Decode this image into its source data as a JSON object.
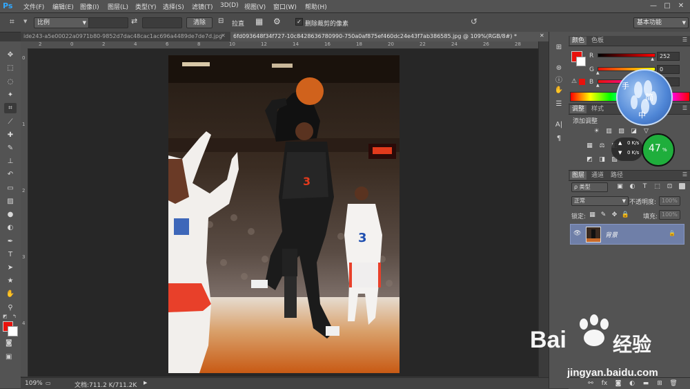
{
  "app": {
    "logo": "Ps",
    "menus": [
      "文件(F)",
      "编辑(E)",
      "图像(I)",
      "图层(L)",
      "类型(Y)",
      "选择(S)",
      "滤镜(T)",
      "3D(D)",
      "视图(V)",
      "窗口(W)",
      "帮助(H)"
    ],
    "window_controls": {
      "minimize": "—",
      "restore": "□",
      "close": "✕"
    }
  },
  "options_bar": {
    "ratio_select": "比例",
    "swap_symbol": "⇄",
    "clear_button": "清除",
    "straighten_label": "拉直",
    "delete_cropped_label": "删除裁剪的像素",
    "delete_cropped_checked": true,
    "workspace_select": "基本功能"
  },
  "tabs": [
    {
      "label": "ide243-a5e00022a0971b80-9852d7dac48cac1ac696a4489de7de7d.jpg",
      "close": "✕",
      "active": false
    },
    {
      "label": "6fd093648f34f727-10c8428636780990-750a0af875ef460dc24e43f7ab386585.jpg @ 109%(RGB/8#) *",
      "close": "✕",
      "active": true
    }
  ],
  "rulers": {
    "top_ticks": [
      "2",
      "0",
      "2",
      "4",
      "6",
      "8",
      "10",
      "12",
      "14",
      "16",
      "18",
      "20",
      "22",
      "24",
      "26",
      "28",
      "30"
    ],
    "left_ticks": [
      "0",
      "1",
      "2",
      "3",
      "4"
    ]
  },
  "tools": [
    {
      "icon": "move-tool-icon",
      "glyph": "✥"
    },
    {
      "icon": "marquee-tool-icon",
      "glyph": "⬚"
    },
    {
      "icon": "lasso-tool-icon",
      "glyph": "◌"
    },
    {
      "icon": "magic-wand-icon",
      "glyph": "✦"
    },
    {
      "icon": "crop-tool-icon",
      "glyph": "⌗"
    },
    {
      "icon": "eyedropper-icon",
      "glyph": "⟋"
    },
    {
      "icon": "healing-brush-icon",
      "glyph": "✚"
    },
    {
      "icon": "brush-tool-icon",
      "glyph": "✎"
    },
    {
      "icon": "clone-stamp-icon",
      "glyph": "⊥"
    },
    {
      "icon": "history-brush-icon",
      "glyph": "↶"
    },
    {
      "icon": "eraser-icon",
      "glyph": "▭"
    },
    {
      "icon": "gradient-tool-icon",
      "glyph": "▨"
    },
    {
      "icon": "blur-tool-icon",
      "glyph": "●"
    },
    {
      "icon": "dodge-tool-icon",
      "glyph": "◐"
    },
    {
      "icon": "pen-tool-icon",
      "glyph": "✒"
    },
    {
      "icon": "type-tool-icon",
      "glyph": "T"
    },
    {
      "icon": "path-select-icon",
      "glyph": "➤"
    },
    {
      "icon": "shape-tool-icon",
      "glyph": "★"
    },
    {
      "icon": "hand-tool-icon",
      "glyph": "✋"
    },
    {
      "icon": "zoom-tool-icon",
      "glyph": "⚲"
    }
  ],
  "colors": {
    "foreground": "#e8120c",
    "background": "#ffffff",
    "accent": "#31a8ff"
  },
  "status": {
    "zoom": "109%",
    "doc_info": "文档:711.2 K/711.2K",
    "arrow": "▶"
  },
  "panels": {
    "color": {
      "tab_active": "颜色",
      "tab_other": "色板",
      "channels": [
        {
          "label": "R",
          "value": "252",
          "fraction": 0.99
        },
        {
          "label": "G",
          "value": "0",
          "fraction": 0.0
        },
        {
          "label": "B",
          "value": "0",
          "fraction": 0.0
        }
      ]
    },
    "adjustments": {
      "tab_active": "调整",
      "tab_other": "样式",
      "add_label": "添加调整"
    },
    "layers": {
      "tabs": [
        "图层",
        "通道",
        "路径"
      ],
      "filter_select": "ρ 类型",
      "blend_mode": "正常",
      "opacity_label": "不透明度:",
      "opacity_value": "100%",
      "lock_label": "锁定:",
      "fill_label": "填充:",
      "fill_value": "100%",
      "layer_name": "背景",
      "layer_visible_glyph": "👁",
      "layer_lock_glyph": "🔒"
    }
  },
  "overlays": {
    "badge_chars": [
      "手",
      "简",
      "中"
    ],
    "speed_up": "0 K/s",
    "speed_down": "0 K/s",
    "percent": "47",
    "percent_sign": "%",
    "watermark_logo": "Bai",
    "watermark_logo2": "经验",
    "watermark_url": "jingyan.baidu.com"
  }
}
